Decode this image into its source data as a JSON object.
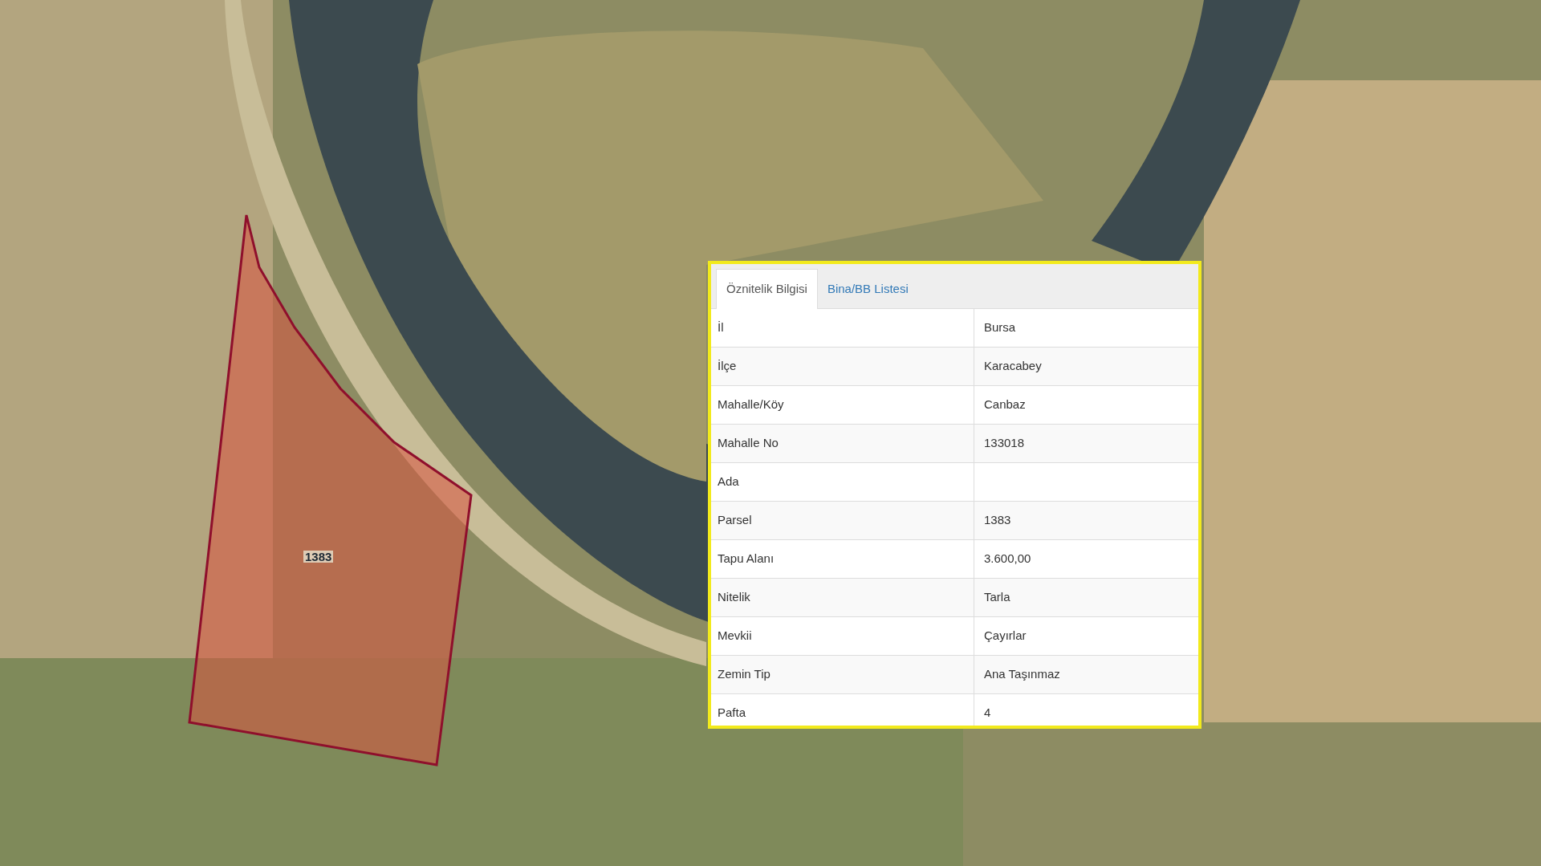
{
  "map": {
    "parcel_label": "1383"
  },
  "popup": {
    "tabs": [
      {
        "label": "Öznitelik Bilgisi",
        "selected": true
      },
      {
        "label": "Bina/BB Listesi",
        "selected": false
      }
    ],
    "rows": [
      {
        "label": "İl",
        "value": "Bursa"
      },
      {
        "label": "İlçe",
        "value": "Karacabey"
      },
      {
        "label": "Mahalle/Köy",
        "value": "Canbaz"
      },
      {
        "label": "Mahalle No",
        "value": "133018"
      },
      {
        "label": "Ada",
        "value": ""
      },
      {
        "label": "Parsel",
        "value": "1383"
      },
      {
        "label": "Tapu Alanı",
        "value": "3.600,00"
      },
      {
        "label": "Nitelik",
        "value": "Tarla"
      },
      {
        "label": "Mevkii",
        "value": "Çayırlar"
      },
      {
        "label": "Zemin Tip",
        "value": "Ana Taşınmaz"
      },
      {
        "label": "Pafta",
        "value": "4"
      }
    ]
  }
}
